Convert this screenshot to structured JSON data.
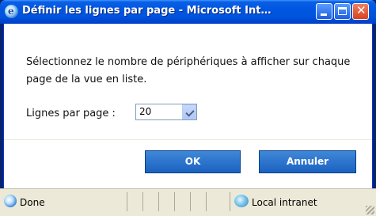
{
  "window": {
    "title": "Définir les lignes par page - Microsoft Int…",
    "icon": "ie-icon"
  },
  "dialog": {
    "message": "Sélectionnez le nombre de périphériques à afficher sur chaque page de la vue en liste.",
    "lines_label": "Lignes par page :",
    "lines_value": "20",
    "ok_label": "OK",
    "cancel_label": "Annuler"
  },
  "statusbar": {
    "status_text": "Done",
    "zone_text": "Local intranet"
  },
  "colors": {
    "titlebar": "#0054e3",
    "button": "#2b74cf",
    "chrome": "#ece9d8"
  }
}
